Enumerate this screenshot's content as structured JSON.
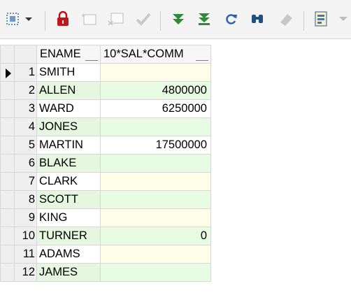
{
  "toolbar": {
    "buttons": [
      {
        "icon": "grid-select-icon",
        "enabled": true
      },
      {
        "icon": "dropdown-arrow-icon",
        "enabled": true
      },
      {
        "icon": "lock-icon",
        "enabled": true
      },
      {
        "icon": "insert-record-icon",
        "enabled": false
      },
      {
        "icon": "delete-record-icon",
        "enabled": false
      },
      {
        "icon": "post-changes-icon",
        "enabled": false
      },
      {
        "icon": "fetch-next-page-icon",
        "enabled": true
      },
      {
        "icon": "fetch-last-page-icon",
        "enabled": true
      },
      {
        "icon": "refresh-icon",
        "enabled": true
      },
      {
        "icon": "find-icon",
        "enabled": true
      },
      {
        "icon": "clear-icon",
        "enabled": false
      },
      {
        "icon": "single-record-view-icon",
        "enabled": true
      },
      {
        "icon": "more-arrow-icon",
        "enabled": false
      }
    ]
  },
  "grid": {
    "columns": [
      "ENAME",
      "10*SAL*COMM"
    ],
    "rows": [
      {
        "num": "1",
        "ename": "SMITH",
        "value": ""
      },
      {
        "num": "2",
        "ename": "ALLEN",
        "value": "4800000"
      },
      {
        "num": "3",
        "ename": "WARD",
        "value": "6250000"
      },
      {
        "num": "4",
        "ename": "JONES",
        "value": ""
      },
      {
        "num": "5",
        "ename": "MARTIN",
        "value": "17500000"
      },
      {
        "num": "6",
        "ename": "BLAKE",
        "value": ""
      },
      {
        "num": "7",
        "ename": "CLARK",
        "value": ""
      },
      {
        "num": "8",
        "ename": "SCOTT",
        "value": ""
      },
      {
        "num": "9",
        "ename": "KING",
        "value": ""
      },
      {
        "num": "10",
        "ename": "TURNER",
        "value": "0"
      },
      {
        "num": "11",
        "ename": "ADAMS",
        "value": ""
      },
      {
        "num": "12",
        "ename": "JAMES",
        "value": ""
      }
    ],
    "colors": {
      "ename_even_bg": "#e6f7e0",
      "value_odd_bg": "#fefde8",
      "value_even_bg": "#e8fbe3",
      "white": "#ffffff"
    },
    "current_row": 1
  }
}
